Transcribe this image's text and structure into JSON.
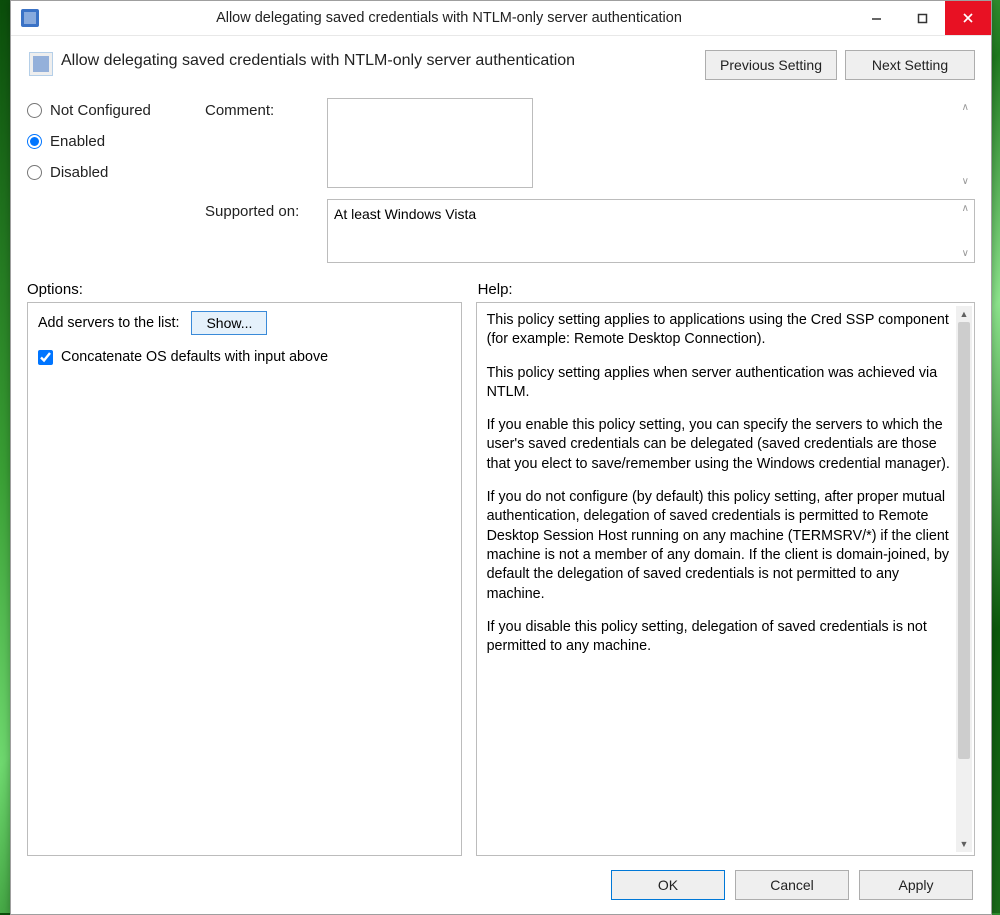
{
  "window": {
    "title": "Allow delegating saved credentials with NTLM-only server authentication"
  },
  "header": {
    "policy_title": "Allow delegating saved credentials with NTLM-only server authentication",
    "prev_btn": "Previous Setting",
    "next_btn": "Next Setting"
  },
  "state": {
    "not_configured": "Not Configured",
    "enabled": "Enabled",
    "disabled": "Disabled",
    "selected": "Enabled"
  },
  "fields": {
    "comment_label": "Comment:",
    "comment_value": "",
    "supported_label": "Supported on:",
    "supported_value": "At least Windows Vista"
  },
  "labels": {
    "options": "Options:",
    "help": "Help:"
  },
  "options": {
    "add_servers_label": "Add servers to the list:",
    "show_btn": "Show...",
    "concat_label": "Concatenate OS defaults with input above",
    "concat_checked": true
  },
  "help": {
    "p1": "This policy setting applies to applications using the Cred SSP component (for example: Remote Desktop Connection).",
    "p2": "This policy setting applies when server authentication was achieved via NTLM.",
    "p3": "If you enable this policy setting, you can specify the servers to which the user's saved credentials can be delegated (saved credentials are those that you elect to save/remember using the Windows credential manager).",
    "p4": "If you do not configure (by default) this policy setting, after proper mutual authentication, delegation of saved credentials is permitted to Remote Desktop Session Host running on any machine (TERMSRV/*) if the client machine is not a member of any domain. If the client is domain-joined, by default the delegation of saved credentials is not permitted to any machine.",
    "p5": "If you disable this policy setting, delegation of saved credentials is not permitted to any machine."
  },
  "footer": {
    "ok": "OK",
    "cancel": "Cancel",
    "apply": "Apply"
  }
}
